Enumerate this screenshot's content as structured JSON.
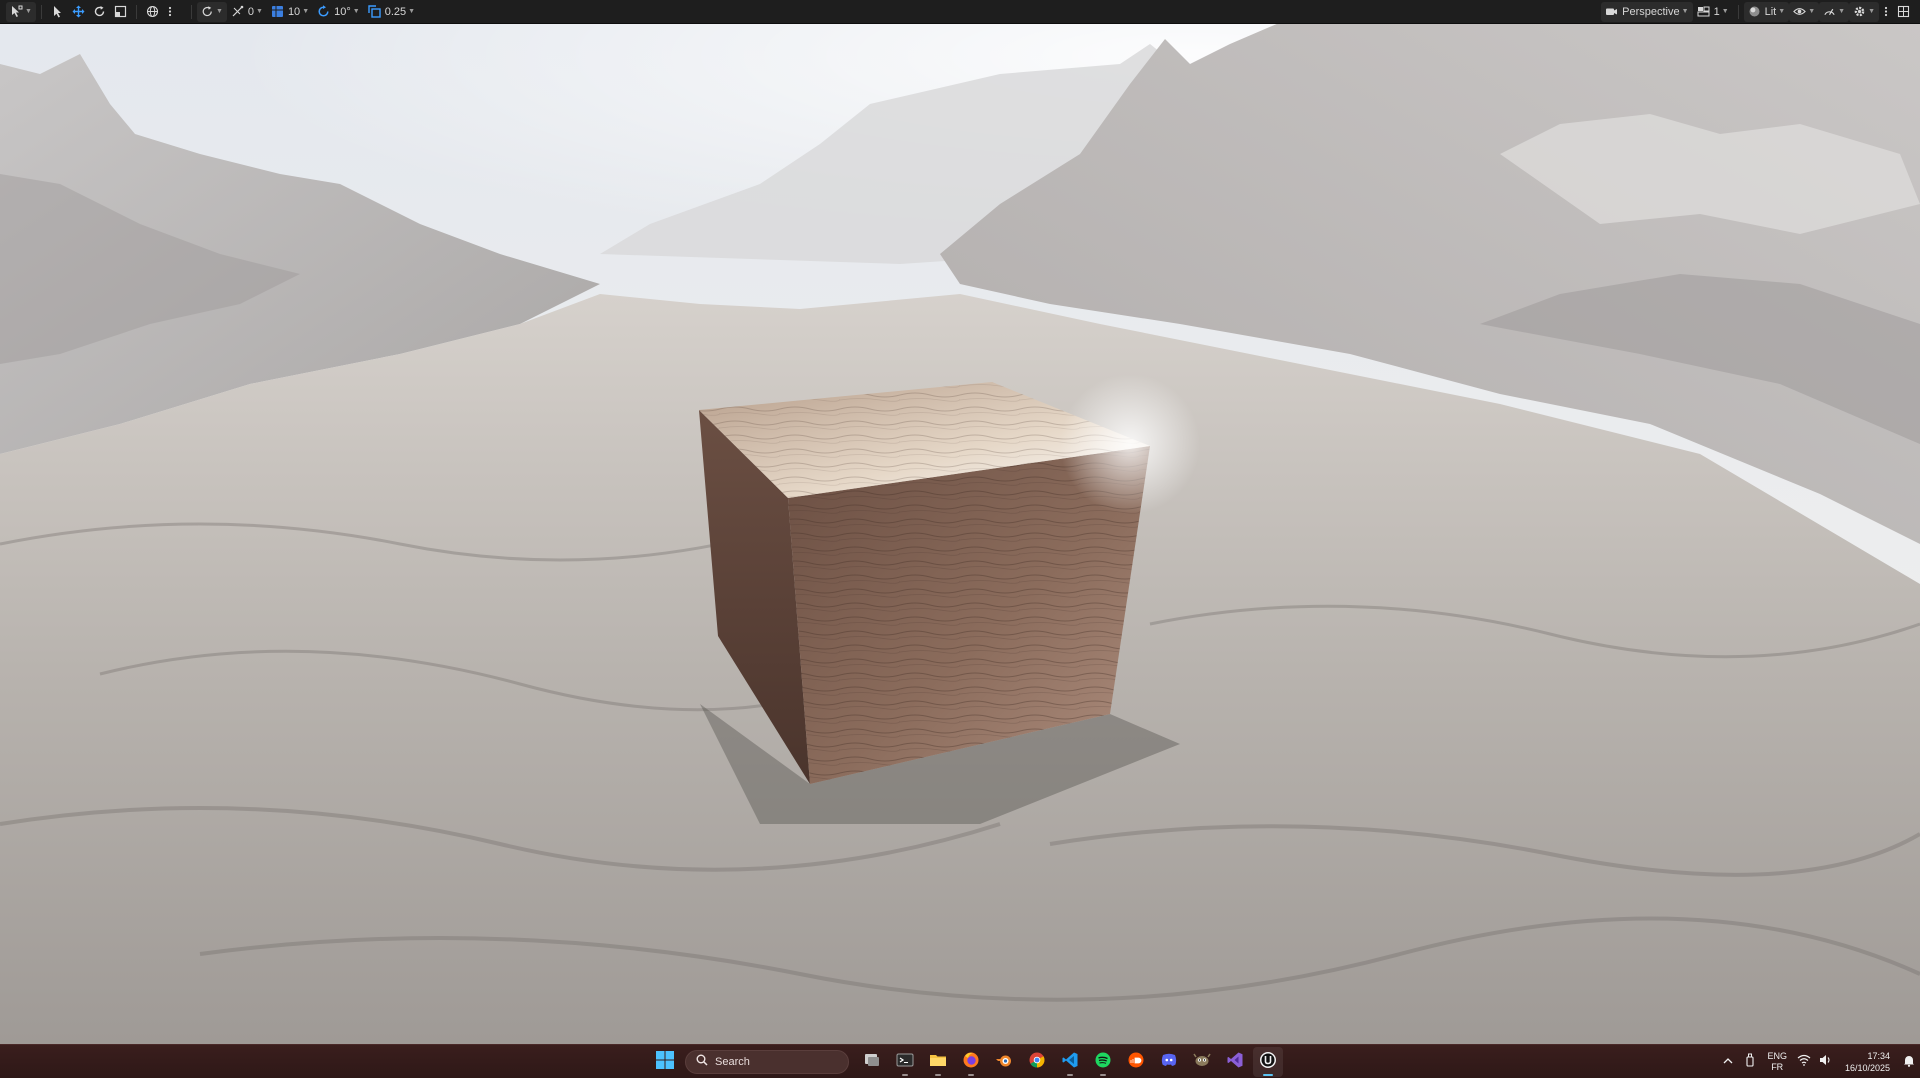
{
  "toolbar": {
    "left": [
      {
        "name": "select-mode-button",
        "icon": "select-mode-icon",
        "label": ""
      },
      {
        "name": "select-tool-button",
        "icon": "cursor-arrow-icon",
        "label": ""
      },
      {
        "name": "move-tool-button",
        "icon": "move-arrows-icon",
        "label": ""
      },
      {
        "name": "rotate-tool-button",
        "icon": "rotate-icon",
        "label": ""
      },
      {
        "name": "scale-tool-button",
        "icon": "scale-icon",
        "label": ""
      },
      {
        "name": "world-local-button",
        "icon": "globe-icon",
        "label": ""
      },
      {
        "name": "more-options-button",
        "icon": "kebab-icon",
        "label": ""
      }
    ],
    "snaps": [
      {
        "name": "surface-snap-button",
        "icon": "surface-snap-icon",
        "label": ""
      },
      {
        "name": "vertex-snap-button",
        "icon": "vertex-snap-icon",
        "label": "0"
      },
      {
        "name": "grid-snap-button",
        "icon": "grid-snap-icon",
        "label": "10"
      },
      {
        "name": "rotation-snap-button",
        "icon": "rotation-snap-icon",
        "label": "10°"
      },
      {
        "name": "scale-snap-button",
        "icon": "scale-snap-icon",
        "label": "0.25"
      }
    ],
    "right": [
      {
        "name": "perspective-button",
        "icon": "camera-icon",
        "label": "Perspective"
      },
      {
        "name": "viewport-layout-button",
        "icon": "layout-icon",
        "label": "1"
      },
      {
        "name": "view-mode-button",
        "icon": "lit-sphere-icon",
        "label": "Lit"
      },
      {
        "name": "show-flags-button",
        "icon": "eye-icon",
        "label": ""
      },
      {
        "name": "performance-button",
        "icon": "gauge-icon",
        "label": ""
      },
      {
        "name": "viewport-settings-button",
        "icon": "gear-icon",
        "label": ""
      },
      {
        "name": "viewport-options-button",
        "icon": "kebab-icon",
        "label": ""
      },
      {
        "name": "viewport-maximize-button",
        "icon": "grid-layout-icon",
        "label": ""
      }
    ]
  },
  "scene": {
    "sky_color": "#e9ecef",
    "mountain_color": "#c9c6c4",
    "ground_color": "#bdb8b4",
    "cube_top_color": "#d9c7b4",
    "cube_front_color": "#8a6a58",
    "cube_side_color": "#5a4035"
  },
  "taskbar": {
    "search_placeholder": "Search",
    "apps": [
      {
        "name": "task-view",
        "icon": "task-view-icon",
        "active": false
      },
      {
        "name": "terminal",
        "icon": "terminal-icon",
        "active": false
      },
      {
        "name": "file-explorer",
        "icon": "folder-icon",
        "active": false
      },
      {
        "name": "firefox",
        "icon": "firefox-icon",
        "active": false
      },
      {
        "name": "blender",
        "icon": "blender-icon",
        "active": false
      },
      {
        "name": "chrome",
        "icon": "chrome-icon",
        "active": false
      },
      {
        "name": "vscode",
        "icon": "vscode-icon",
        "active": false
      },
      {
        "name": "spotify",
        "icon": "spotify-icon",
        "active": false
      },
      {
        "name": "soundcloud",
        "icon": "soundcloud-icon",
        "active": false
      },
      {
        "name": "discord",
        "icon": "discord-icon",
        "active": false
      },
      {
        "name": "gimp",
        "icon": "gimp-icon",
        "active": false
      },
      {
        "name": "visual-studio",
        "icon": "visual-studio-icon",
        "active": false
      },
      {
        "name": "unreal-engine",
        "icon": "unreal-engine-icon",
        "active": true
      }
    ],
    "lang_primary": "ENG",
    "lang_secondary": "FR",
    "time": "17:34",
    "date": "16/10/2025"
  }
}
